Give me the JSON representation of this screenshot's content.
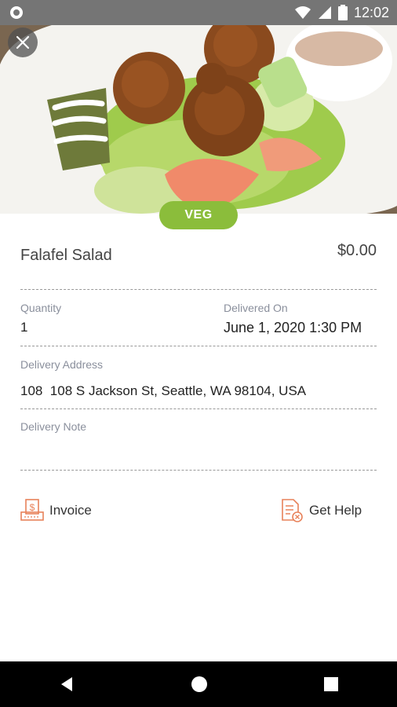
{
  "status_bar": {
    "time": "12:02"
  },
  "header": {
    "badge": "VEG"
  },
  "item": {
    "name": "Falafel Salad",
    "price": "$0.00"
  },
  "details": {
    "quantity_label": "Quantity",
    "quantity_value": "1",
    "delivered_on_label": "Delivered On",
    "delivered_on_value": "June 1, 2020 1:30 PM",
    "address_label": "Delivery Address",
    "address_value": "108  108 S Jackson St, Seattle, WA 98104, USA",
    "note_label": "Delivery Note",
    "note_value": ""
  },
  "actions": {
    "invoice_label": "Invoice",
    "help_label": "Get Help"
  },
  "colors": {
    "accent": "#8bbd3b",
    "icon_orange": "#e8825a",
    "status_bar": "#757575"
  }
}
